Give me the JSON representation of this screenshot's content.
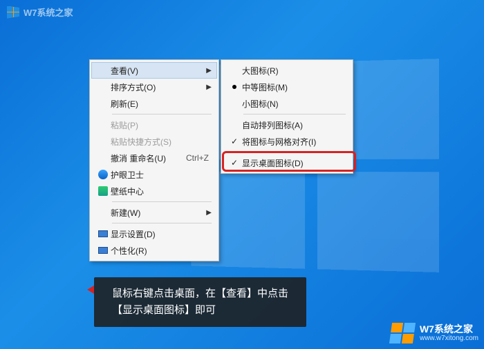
{
  "menu1": {
    "view": {
      "label": "查看(V)"
    },
    "sort": {
      "label": "排序方式(O)"
    },
    "refresh": {
      "label": "刷新(E)"
    },
    "paste": {
      "label": "粘贴(P)"
    },
    "paste_sc": {
      "label": "粘贴快捷方式(S)"
    },
    "undo": {
      "label": "撤消 重命名(U)",
      "accel": "Ctrl+Z"
    },
    "eye": {
      "label": "护眼卫士"
    },
    "wall": {
      "label": "壁纸中心"
    },
    "new": {
      "label": "新建(W)"
    },
    "display": {
      "label": "显示设置(D)"
    },
    "personal": {
      "label": "个性化(R)"
    }
  },
  "menu2": {
    "large": {
      "label": "大图标(R)"
    },
    "medium": {
      "label": "中等图标(M)"
    },
    "small": {
      "label": "小图标(N)"
    },
    "auto": {
      "label": "自动排列图标(A)"
    },
    "align": {
      "label": "将图标与网格对齐(I)"
    },
    "show": {
      "label": "显示桌面图标(D)"
    }
  },
  "caption": {
    "line1": "鼠标右键点击桌面，在【查看】中点击",
    "line2": "【显示桌面图标】即可"
  },
  "watermark": {
    "top": "W7系统之家",
    "brand": "W7系统之家",
    "url": "www.w7xitong.com"
  }
}
